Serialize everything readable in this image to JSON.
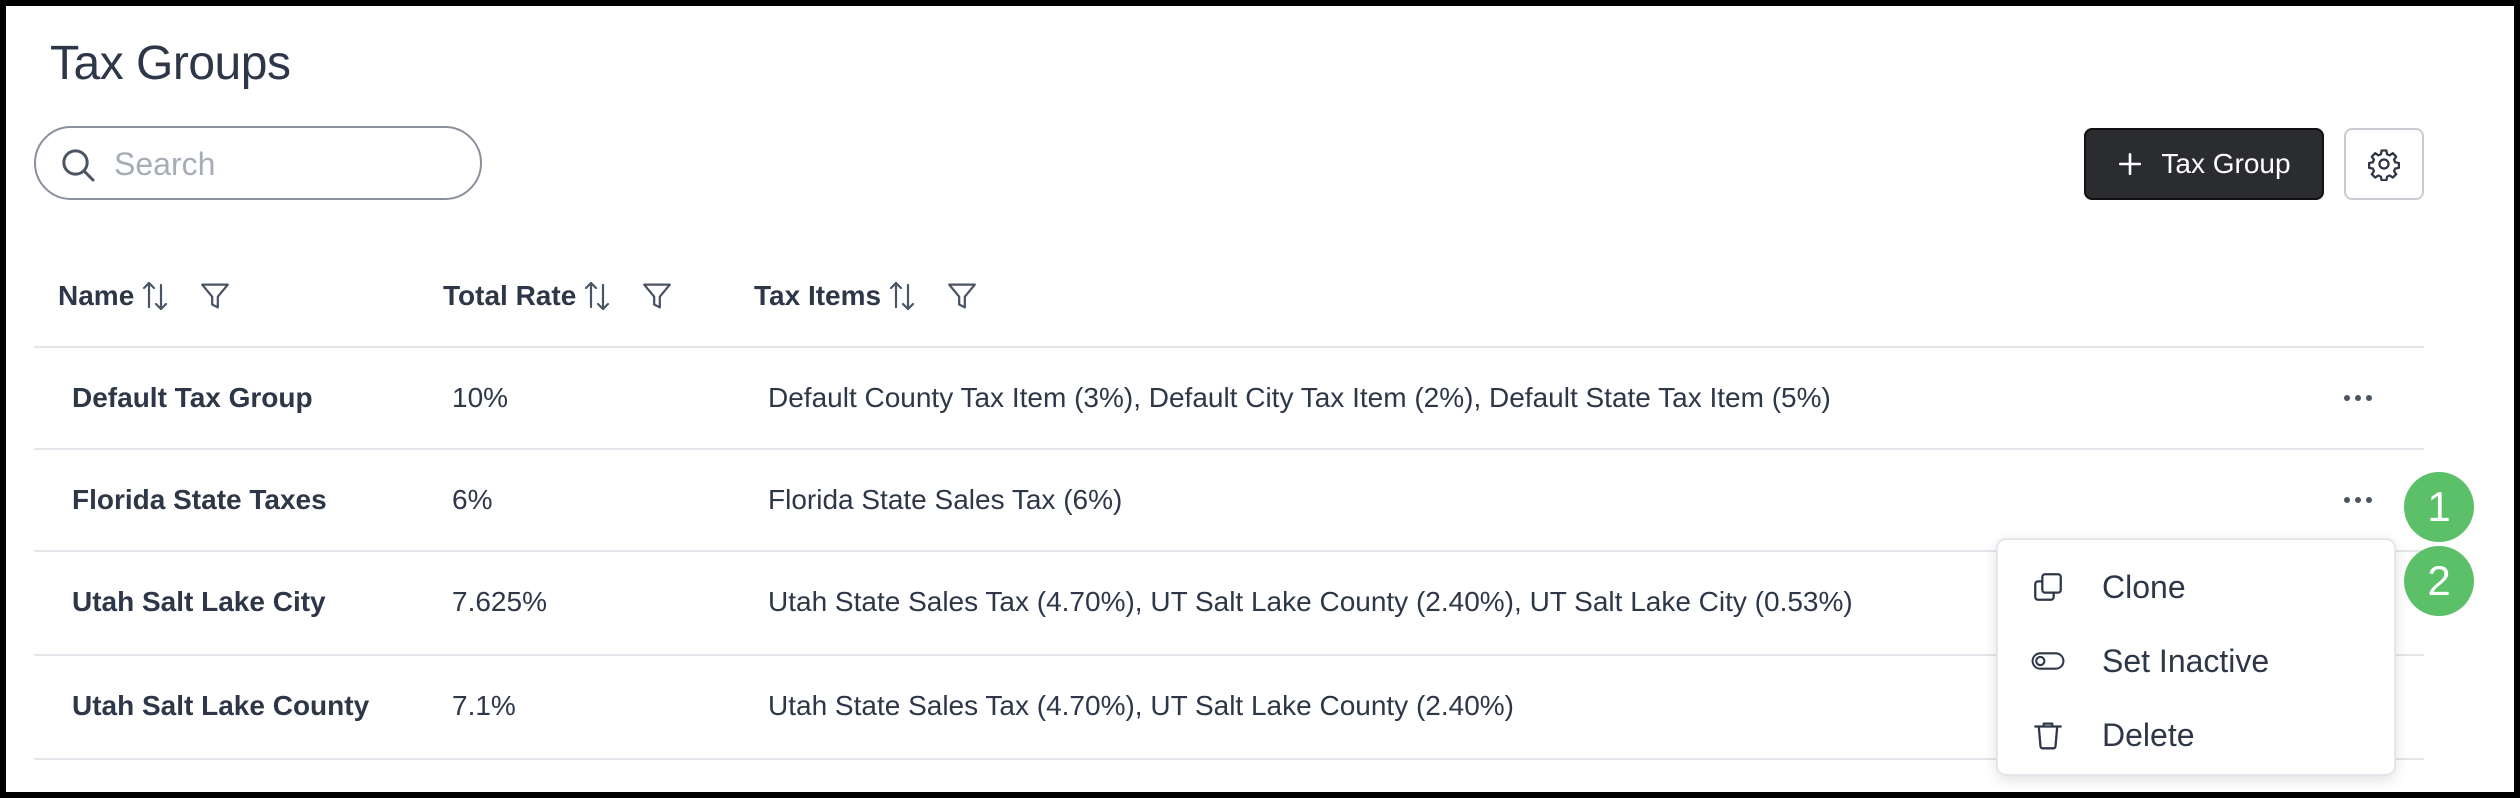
{
  "page": {
    "title": "Tax Groups"
  },
  "search": {
    "placeholder": "Search",
    "icon": "search-icon"
  },
  "toolbar": {
    "add_label": "Tax Group",
    "add_icon": "plus-icon",
    "settings_icon": "gear-icon"
  },
  "table": {
    "columns": [
      {
        "label": "Name",
        "sortable": true,
        "filterable": true
      },
      {
        "label": "Total Rate",
        "sortable": true,
        "filterable": true
      },
      {
        "label": "Tax Items",
        "sortable": true,
        "filterable": true
      }
    ],
    "rows": [
      {
        "name": "Default Tax Group",
        "rate": "10%",
        "items": "Default County Tax Item (3%), Default City Tax Item (2%), Default State Tax Item (5%)"
      },
      {
        "name": "Florida State Taxes",
        "rate": "6%",
        "items": "Florida State Sales Tax (6%)"
      },
      {
        "name": "Utah Salt Lake City",
        "rate": "7.625%",
        "items": "Utah State Sales Tax (4.70%), UT Salt Lake County (2.40%), UT Salt Lake City (0.53%)"
      },
      {
        "name": "Utah Salt Lake County",
        "rate": "7.1%",
        "items": "Utah State Sales Tax (4.70%), UT Salt Lake County (2.40%)"
      }
    ]
  },
  "context_menu": {
    "items": [
      {
        "label": "Clone",
        "icon": "copy-icon"
      },
      {
        "label": "Set Inactive",
        "icon": "toggle-off-icon"
      },
      {
        "label": "Delete",
        "icon": "trash-icon"
      }
    ]
  },
  "annotations": {
    "step1": "1",
    "step2": "2"
  },
  "colors": {
    "primary_button": "#2b2c2f",
    "badge": "#5cc069",
    "text": "#2d3748",
    "divider": "#e3e6ea"
  }
}
